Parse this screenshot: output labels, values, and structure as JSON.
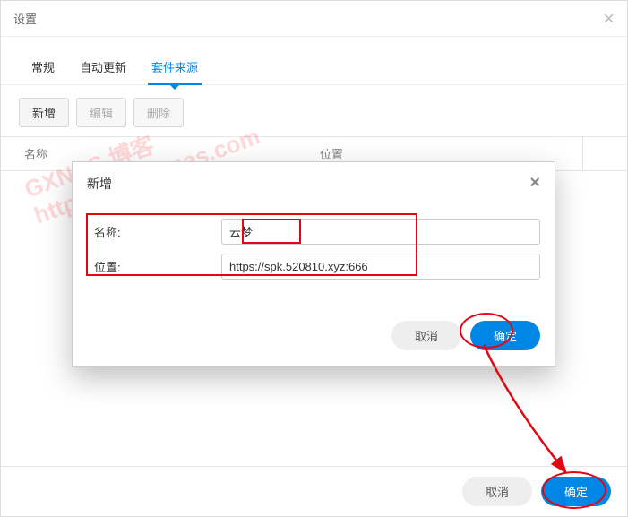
{
  "window": {
    "title": "设置",
    "close_label": "×"
  },
  "tabs": {
    "items": [
      {
        "label": "常规",
        "active": false
      },
      {
        "label": "自动更新",
        "active": false
      },
      {
        "label": "套件来源",
        "active": true
      }
    ]
  },
  "toolbar": {
    "add": "新增",
    "edit": "编辑",
    "delete": "删除"
  },
  "table": {
    "col_name": "名称",
    "col_location": "位置"
  },
  "footer": {
    "cancel": "取消",
    "confirm": "确定"
  },
  "dialog": {
    "title": "新增",
    "close": "×",
    "fields": {
      "name_label": "名称:",
      "name_value": "云梦",
      "location_label": "位置:",
      "location_value": "https://spk.520810.xyz:666"
    },
    "cancel": "取消",
    "confirm": "确定"
  },
  "watermark": {
    "line1": "GXNAS 博客",
    "line2": "https://wp.gxnas.com"
  }
}
